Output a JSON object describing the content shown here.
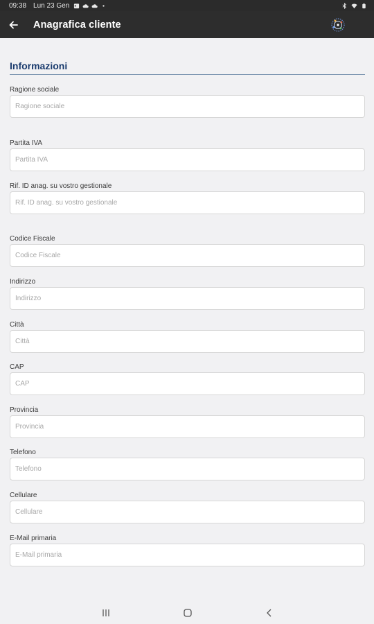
{
  "status_bar": {
    "time": "09:38",
    "date": "Lun 23 Gen"
  },
  "app_bar": {
    "title": "Anagrafica cliente"
  },
  "section": {
    "title": "Informazioni"
  },
  "fields": [
    {
      "label": "Ragione sociale",
      "placeholder": "Ragione sociale",
      "value": ""
    },
    {
      "label": "Partita IVA",
      "placeholder": "Partita IVA",
      "value": ""
    },
    {
      "label": "Rif. ID anag. su vostro gestionale",
      "placeholder": "Rif. ID anag. su vostro gestionale",
      "value": ""
    },
    {
      "label": "Codice Fiscale",
      "placeholder": "Codice Fiscale",
      "value": ""
    },
    {
      "label": "Indirizzo",
      "placeholder": "Indirizzo",
      "value": ""
    },
    {
      "label": "Città",
      "placeholder": "Città",
      "value": ""
    },
    {
      "label": "CAP",
      "placeholder": "CAP",
      "value": ""
    },
    {
      "label": "Provincia",
      "placeholder": "Provincia",
      "value": ""
    },
    {
      "label": "Telefono",
      "placeholder": "Telefono",
      "value": ""
    },
    {
      "label": "Cellulare",
      "placeholder": "Cellulare",
      "value": ""
    },
    {
      "label": "E-Mail primaria",
      "placeholder": "E-Mail primaria",
      "value": ""
    }
  ],
  "colors": {
    "app_bar": "#2d2d2d",
    "section_title": "#1b3c6e",
    "background": "#f1f1f3"
  },
  "icons": {
    "back": "arrow-back-icon",
    "logo": "app-logo",
    "nav_recents": "recents-icon",
    "nav_home": "home-icon",
    "nav_back": "nav-back-icon"
  }
}
